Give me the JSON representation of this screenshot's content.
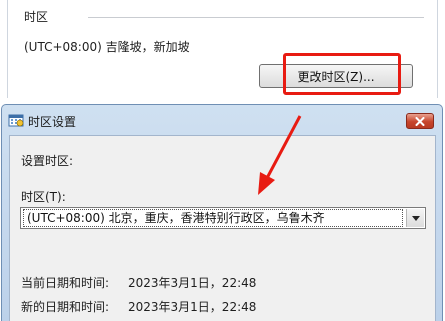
{
  "background_panel": {
    "group_title": "时区",
    "current_timezone": "(UTC+08:00) 吉隆坡，新加坡",
    "change_button_label": "更改时区(Z)..."
  },
  "dialog": {
    "title": "时区设置",
    "set_label": "设置时区:",
    "timezone_label": "时区(T):",
    "timezone_selected": "(UTC+08:00) 北京，重庆，香港特别行政区，乌鲁木齐",
    "current_datetime_label": "当前日期和时间:",
    "current_datetime_value": "2023年3月1日，22:48",
    "new_datetime_label": "新的日期和时间:",
    "new_datetime_value": "2023年3月1日，22:48"
  },
  "annotation": {
    "color": "#e81b12"
  },
  "colors": {
    "dialog_frame": "#bcd1ea",
    "close_button": "#c7452c"
  }
}
